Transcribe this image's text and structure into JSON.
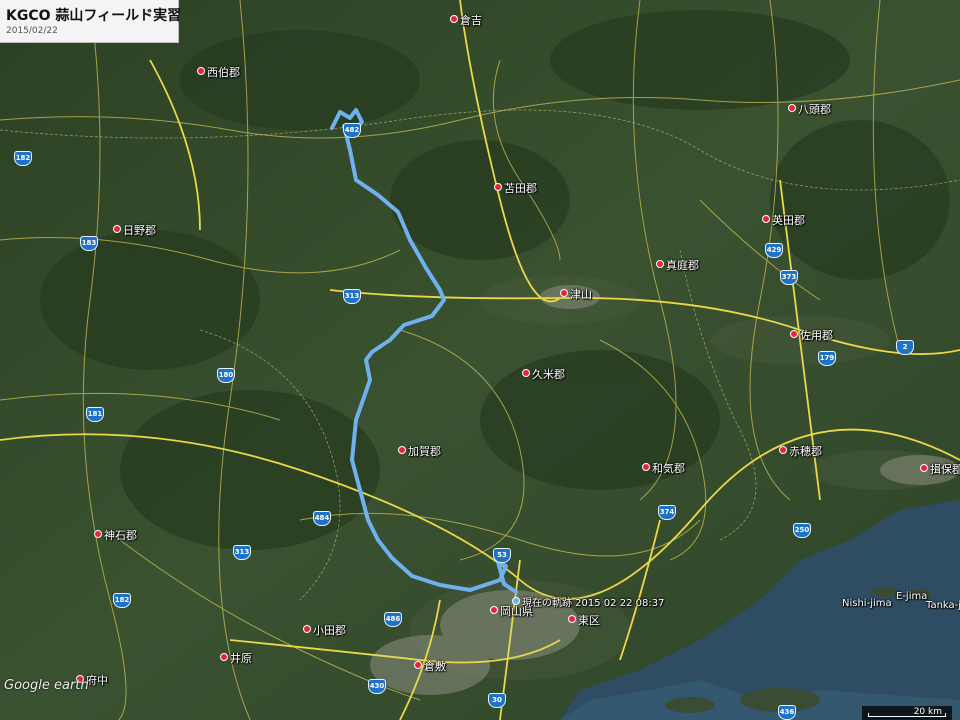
{
  "title": {
    "main": "KGCO 蒜山フィールド実習",
    "date": "2015/02/22"
  },
  "places": [
    {
      "name": "倉吉"
    },
    {
      "name": "西伯郡"
    },
    {
      "name": "八頭郡"
    },
    {
      "name": "日野郡"
    },
    {
      "name": "苫田郡"
    },
    {
      "name": "英田郡"
    },
    {
      "name": "真庭郡"
    },
    {
      "name": "津山"
    },
    {
      "name": "佐用郡"
    },
    {
      "name": "久米郡"
    },
    {
      "name": "加賀郡"
    },
    {
      "name": "赤穂郡"
    },
    {
      "name": "和気郡"
    },
    {
      "name": "揖保郡"
    },
    {
      "name": "神石郡"
    },
    {
      "name": "小田郡"
    },
    {
      "name": "井原"
    },
    {
      "name": "府中"
    },
    {
      "name": "倉敷"
    },
    {
      "name": "東区"
    },
    {
      "name": "岡山県"
    },
    {
      "name": "Nishi-jima"
    },
    {
      "name": "E-jima"
    },
    {
      "name": "Tanka-jima"
    }
  ],
  "track_label": "現在の軌跡 2015 02 22 08:37",
  "route_shields": [
    "482",
    "182",
    "183",
    "313",
    "180",
    "181",
    "484",
    "53",
    "182",
    "486",
    "313",
    "374",
    "429",
    "373",
    "179",
    "250",
    "2",
    "29",
    "430",
    "30",
    "2",
    "436"
  ],
  "branding": {
    "logo": "Google earth"
  },
  "scale": {
    "label": "20 km"
  },
  "colors": {
    "track": "#6fb1ee",
    "road_major": "#e8d84a",
    "road_minor": "#cdbf55",
    "sea": "#2e4d63",
    "forest": "#2f4a27"
  }
}
